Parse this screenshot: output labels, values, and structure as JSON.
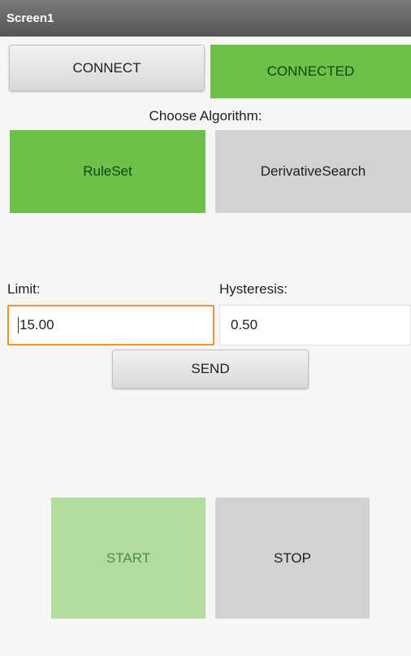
{
  "screen": {
    "title": "Screen1"
  },
  "connection": {
    "connect_label": "CONNECT",
    "status_label": "CONNECTED"
  },
  "algorithm": {
    "prompt": "Choose Algorithm:",
    "options": [
      "RuleSet",
      "DerivativeSearch"
    ],
    "selected": "RuleSet"
  },
  "params": {
    "limit_label": "Limit:",
    "limit_value": "15.00",
    "hysteresis_label": "Hysteresis:",
    "hysteresis_value": "0.50"
  },
  "send_label": "SEND",
  "controls": {
    "start_label": "START",
    "stop_label": "STOP"
  },
  "colors": {
    "accent_green": "#6ec04a",
    "disabled_green": "#b2dca0",
    "focus_orange": "#f0922a",
    "titlebar": "#666666"
  }
}
